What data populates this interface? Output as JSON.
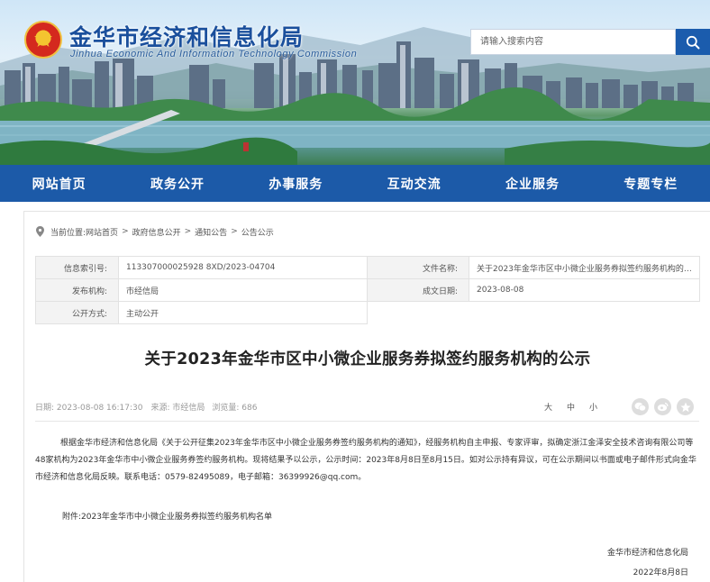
{
  "header": {
    "title": "金华市经济和信息化局",
    "subtitle": "Jinhua Economic And Information Technology Commission",
    "emblem_icon": "national-emblem-icon",
    "search": {
      "placeholder": "请输入搜索内容",
      "button_icon": "search-icon"
    }
  },
  "nav": {
    "items": [
      {
        "label": "网站首页"
      },
      {
        "label": "政务公开"
      },
      {
        "label": "办事服务"
      },
      {
        "label": "互动交流"
      },
      {
        "label": "企业服务"
      },
      {
        "label": "专题专栏"
      }
    ]
  },
  "breadcrumb": {
    "icon": "location-pin-icon",
    "prefix": "当前位置:",
    "items": [
      "网站首页",
      "政府信息公开",
      "通知公告",
      "公告公示"
    ],
    "separator": ">"
  },
  "meta": {
    "index_label": "信息索引号:",
    "index_value": "113307000025928 8XD/2023-04704",
    "filename_label": "文件名称:",
    "filename_value": "关于2023年金华市区中小微企业服务券拟签约服务机构的公...",
    "publisher_label": "发布机构:",
    "publisher_value": "市经信局",
    "date_label": "成文日期:",
    "date_value": "2023-08-08",
    "mode_label": "公开方式:",
    "mode_value": "主动公开"
  },
  "article": {
    "title": "关于2023年金华市区中小微企业服务券拟签约服务机构的公示",
    "info": {
      "date": "日期: 2023-08-08 16:17:30",
      "source": "来源: 市经信局",
      "views": "浏览量: 686"
    },
    "font_sizes": [
      "大",
      "中",
      "小"
    ],
    "share_icons": [
      "wechat-icon",
      "weibo-icon",
      "qzone-icon"
    ],
    "body_paragraph": "根据金华市经济和信息化局《关于公开征集2023年金华市区中小微企业服务券签约服务机构的通知》，经服务机构自主申报、专家评审，拟确定浙江金泽安全技术咨询有限公司等48家机构为2023年金华市中小微企业服务券签约服务机构。现将结果予以公示，公示时间：2023年8月8日至8月15日。如对公示持有异议，可在公示期间以书面或电子邮件形式向金华市经济和信息化局反映。联系电话：0579-82495089，电子邮箱：36399926@qq.com。",
    "attachment": "附件:2023年金华市中小微企业服务券拟签约服务机构名单",
    "signer": "金华市经济和信息化局",
    "sign_date": "2022年8月8日"
  },
  "colors": {
    "brand_blue": "#1c5aa8",
    "title_blue": "#1a4f9c",
    "emblem_red": "#d4291e",
    "emblem_gold": "#f4c430"
  }
}
